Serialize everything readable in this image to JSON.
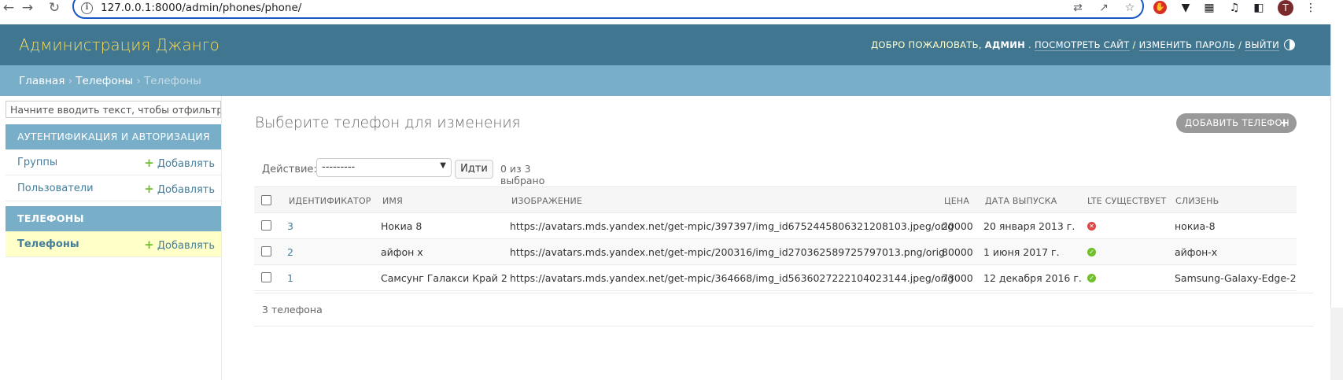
{
  "browser": {
    "url": "127.0.0.1:8000/admin/phones/phone/",
    "profile_initial": "T"
  },
  "header": {
    "branding": "Администрация Джанго",
    "welcome": "ДОБРО ПОЖАЛОВАТЬ, ",
    "username": "АДМИН",
    "view_site": "ПОСМОТРЕТЬ САЙТ",
    "change_password": "ИЗМЕНИТЬ ПАРОЛЬ",
    "logout": "ВЫЙТИ"
  },
  "breadcrumbs": {
    "home": "Главная",
    "app": "Телефоны",
    "current": "Телефоны"
  },
  "sidebar": {
    "filter_placeholder": "Начните вводить текст, чтобы отфильтровать...",
    "modules": [
      {
        "caption": "Аутентификация и авторизация",
        "rows": [
          {
            "label": "Группы",
            "add": "Добавлять"
          },
          {
            "label": "Пользователи",
            "add": "Добавлять"
          }
        ]
      },
      {
        "caption": "Телефоны",
        "rows": [
          {
            "label": "Телефоны",
            "add": "Добавлять"
          }
        ]
      }
    ]
  },
  "content": {
    "title": "Выберите телефон для изменения",
    "add_button": "ДОБАВИТЬ ТЕЛЕФОН",
    "action_label": "Действие:",
    "action_selected": "---------",
    "go_button": "Идти",
    "action_counter": "0 из 3 выбрано",
    "columns": [
      "Идентификатор",
      "Имя",
      "Изображение",
      "Цена",
      "Дата выпуска",
      "LTE существует",
      "Слизень"
    ],
    "rows": [
      {
        "id": "3",
        "name": "Нокиа 8",
        "image": "https://avatars.mds.yandex.net/get-mpic/397397/img_id6752445806321208103.jpeg/orig",
        "price": "20000",
        "release": "20 января 2013 г.",
        "lte": "no",
        "slug": "нокиа-8"
      },
      {
        "id": "2",
        "name": "айфон х",
        "image": "https://avatars.mds.yandex.net/get-mpic/200316/img_id2703625897257970​13.png/orig",
        "price": "80000",
        "release": "1 июня 2017 г.",
        "lte": "yes",
        "slug": "айфон-х"
      },
      {
        "id": "1",
        "name": "Самсунг Галакси Край 2",
        "image": "https://avatars.mds.yandex.net/get-mpic/364668/img_id5636027222104023144.jpeg/orig",
        "price": "73000",
        "release": "12 декабря 2016 г.",
        "lte": "yes",
        "slug": "Samsung-Galaxy-Edge-2"
      }
    ],
    "paginator": "3 телефона"
  }
}
